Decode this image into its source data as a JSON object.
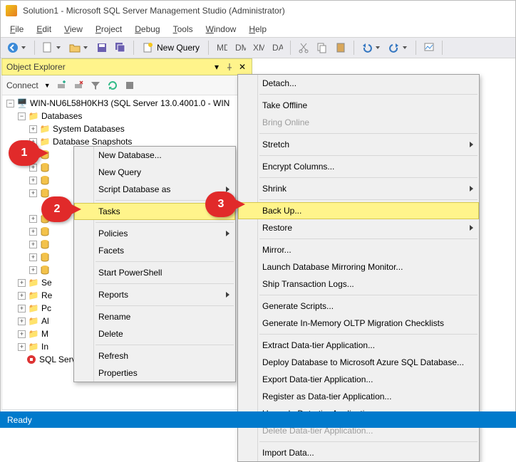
{
  "title": "Solution1 - Microsoft SQL Server Management Studio (Administrator)",
  "menu": {
    "file": "File",
    "edit": "Edit",
    "view": "View",
    "project": "Project",
    "debug": "Debug",
    "tools": "Tools",
    "window": "Window",
    "help": "Help"
  },
  "toolbar": {
    "newQuery": "New Query"
  },
  "panel": {
    "title": "Object Explorer",
    "connect": "Connect"
  },
  "tree": {
    "server": "WIN-NU6L58H0KH3 (SQL Server 13.0.4001.0 - WIN",
    "databases": "Databases",
    "systemDatabases": "System Databases",
    "databaseSnapshots": "Database Snapshots",
    "folders": {
      "se": "Se",
      "re": "Re",
      "pc": "Pc",
      "al": "Al",
      "m": "M",
      "in": "In"
    },
    "agent": "SQL Server Agent (Agent XPs disabled)"
  },
  "cm1": {
    "newDatabase": "New Database...",
    "newQuery": "New Query",
    "scriptDatabaseAs": "Script Database as",
    "tasks": "Tasks",
    "policies": "Policies",
    "facets": "Facets",
    "startPowerShell": "Start PowerShell",
    "reports": "Reports",
    "rename": "Rename",
    "delete": "Delete",
    "refresh": "Refresh",
    "properties": "Properties"
  },
  "cm2": {
    "detach": "Detach...",
    "takeOffline": "Take Offline",
    "bringOnline": "Bring Online",
    "stretch": "Stretch",
    "encryptColumns": "Encrypt Columns...",
    "shrink": "Shrink",
    "backUp": "Back Up...",
    "restore": "Restore",
    "mirror": "Mirror...",
    "launchMirroring": "Launch Database Mirroring Monitor...",
    "shipLogs": "Ship Transaction Logs...",
    "generateScripts": "Generate Scripts...",
    "generateOLTP": "Generate In-Memory OLTP Migration Checklists",
    "extractDataTier": "Extract Data-tier Application...",
    "deployAzure": "Deploy Database to Microsoft Azure SQL Database...",
    "exportDataTier": "Export Data-tier Application...",
    "registerDataTier": "Register as Data-tier Application...",
    "upgradeDataTier": "Upgrade Data-tier Application...",
    "deleteDataTier": "Delete Data-tier Application...",
    "importData": "Import Data..."
  },
  "status": {
    "ready": "Ready"
  },
  "callouts": {
    "c1": "1",
    "c2": "2",
    "c3": "3"
  }
}
